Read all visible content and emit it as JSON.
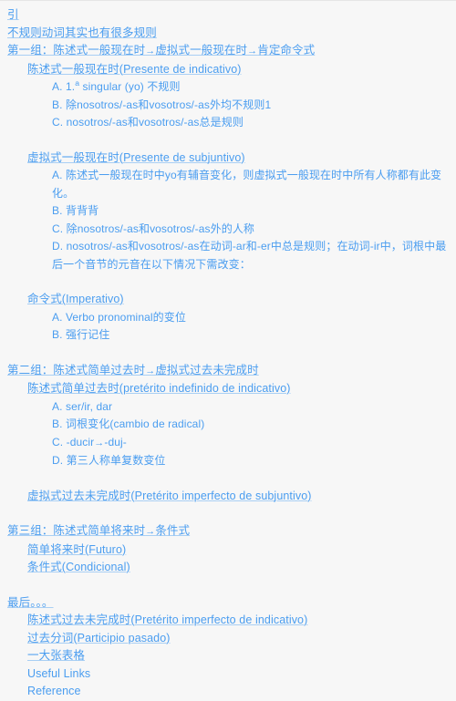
{
  "page": {
    "background_color": "#f7f7f7",
    "link_color": "#4a9df0",
    "top_border_color": "#e6e6e6"
  },
  "outline": [
    {
      "level": 0,
      "gap_before": false,
      "cjk_underline": true,
      "label": "引"
    },
    {
      "level": 0,
      "gap_before": false,
      "cjk_underline": true,
      "label": "不规则动词其实也有很多规则"
    },
    {
      "level": 0,
      "gap_before": false,
      "cjk_underline": true,
      "label": "第一组：陈述式一般现在时→虚拟式一般现在时→肯定命令式"
    },
    {
      "level": 1,
      "gap_before": false,
      "cjk_underline": true,
      "label": "陈述式一般现在时(Presente de indicativo)"
    },
    {
      "level": 2,
      "gap_before": false,
      "cjk_underline": false,
      "label": "A. 1.ª singular (yo) 不规则"
    },
    {
      "level": 2,
      "gap_before": false,
      "cjk_underline": false,
      "label": "B. 除nosotros/-as和vosotros/-as外均不规则1"
    },
    {
      "level": 2,
      "gap_before": false,
      "cjk_underline": false,
      "label": "C. nosotros/-as和vosotros/-as总是规则"
    },
    {
      "level": 1,
      "gap_before": true,
      "cjk_underline": true,
      "label": "虚拟式一般现在时(Presente de subjuntivo)"
    },
    {
      "level": 2,
      "gap_before": false,
      "cjk_underline": false,
      "label": "A. 陈述式一般现在时中yo有辅音变化，则虚拟式一般现在时中所有人称都有此变化。"
    },
    {
      "level": 2,
      "gap_before": false,
      "cjk_underline": false,
      "label": "B. 背背背"
    },
    {
      "level": 2,
      "gap_before": false,
      "cjk_underline": false,
      "label": "C. 除nosotros/-as和vosotros/-as外的人称"
    },
    {
      "level": 2,
      "gap_before": false,
      "cjk_underline": false,
      "label": "D. nosotros/-as和vosotros/-as在动词-ar和-er中总是规则；在动词-ir中，词根中最后一个音节的元音在以下情况下需改变："
    },
    {
      "level": 1,
      "gap_before": true,
      "cjk_underline": true,
      "label": "命令式(Imperativo)"
    },
    {
      "level": 2,
      "gap_before": false,
      "cjk_underline": false,
      "label": "A. Verbo pronominal的变位"
    },
    {
      "level": 2,
      "gap_before": false,
      "cjk_underline": false,
      "label": "B. 强行记住"
    },
    {
      "level": 0,
      "gap_before": true,
      "cjk_underline": true,
      "label": "第二组：陈述式简单过去时→虚拟式过去未完成时"
    },
    {
      "level": 1,
      "gap_before": false,
      "cjk_underline": true,
      "label": "陈述式简单过去时(pretérito indefinido de indicativo)"
    },
    {
      "level": 2,
      "gap_before": false,
      "cjk_underline": false,
      "label": "A. ser/ir, dar"
    },
    {
      "level": 2,
      "gap_before": false,
      "cjk_underline": false,
      "label": "B. 词根变化(cambio de radical)"
    },
    {
      "level": 2,
      "gap_before": false,
      "cjk_underline": false,
      "label": "C. -ducir→-duj-"
    },
    {
      "level": 2,
      "gap_before": false,
      "cjk_underline": false,
      "label": "D. 第三人称单复数变位"
    },
    {
      "level": 1,
      "gap_before": true,
      "cjk_underline": true,
      "label": "虚拟式过去未完成时(Pretérito imperfecto de subjuntivo)"
    },
    {
      "level": 0,
      "gap_before": true,
      "cjk_underline": true,
      "label": "第三组：陈述式简单将来时→条件式"
    },
    {
      "level": 1,
      "gap_before": false,
      "cjk_underline": true,
      "label": "简单将来时(Futuro)"
    },
    {
      "level": 1,
      "gap_before": false,
      "cjk_underline": true,
      "label": "条件式(Condicional)"
    },
    {
      "level": 0,
      "gap_before": true,
      "cjk_underline": true,
      "label": "最后。。。"
    },
    {
      "level": 1,
      "gap_before": false,
      "cjk_underline": true,
      "label": "陈述式过去未完成时(Pretérito imperfecto de indicativo)"
    },
    {
      "level": 1,
      "gap_before": false,
      "cjk_underline": true,
      "label": "过去分词(Participio pasado)"
    },
    {
      "level": 1,
      "gap_before": false,
      "cjk_underline": true,
      "label": "一大张表格"
    },
    {
      "level": 1,
      "gap_before": false,
      "cjk_underline": false,
      "label": "Useful Links"
    },
    {
      "level": 1,
      "gap_before": false,
      "cjk_underline": false,
      "label": "Reference"
    }
  ]
}
